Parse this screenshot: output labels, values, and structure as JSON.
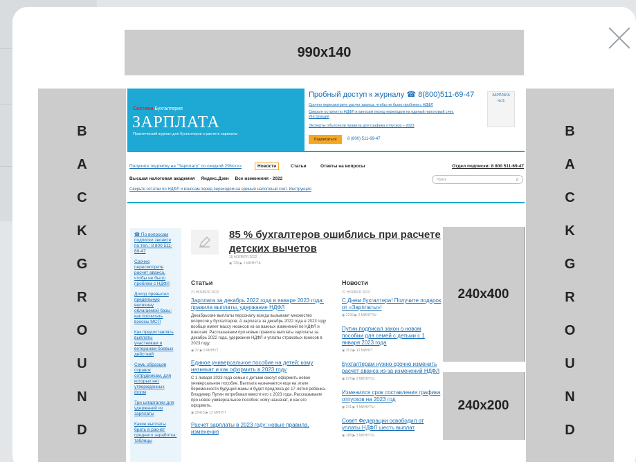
{
  "ads": {
    "top": "990x140",
    "right_tall": "240x400",
    "right_short": "240x200",
    "background_letters": [
      "B",
      "A",
      "C",
      "K",
      "G",
      "R",
      "O",
      "U",
      "N",
      "D"
    ]
  },
  "site": {
    "brand_small": "Бухгалтерия",
    "brand_accent": "Система",
    "title": "ЗАРПЛАТА",
    "tagline": "Практический журнал для бухгалтеров о расчете зарплаты",
    "trial": "Пробный доступ к журналу ☎ 8(800)511-69-47",
    "header_links": [
      "Срочно пересмотрите расчет аванса, чтобы не было проблем с НДФЛ",
      "Сверьте остатки по НДФЛ и взносам перед переходом на единый налоговый счет. Инструкция",
      "Эксперты объяснили правила для графика отпусков – 2023"
    ],
    "subscribe_button": "Подписаться",
    "phone": "8 (800) 511-69-47",
    "cover_title": "ЗАРПЛАТА",
    "cover_issue": "№11",
    "nav_subscribe": "Получите подписку на \"Зарплату\" со скидкой 29%>>>",
    "nav_news": "Новости",
    "nav_articles": "Статьи",
    "nav_questions": "Ответы на вопросы",
    "nav_dept": "Отдел подписки: 8 800 511-69-47",
    "nav2": [
      "Высшая налоговая академия",
      "Яндекс.Дзен",
      "Все изменения - 2022"
    ],
    "search_placeholder": "Поиск",
    "nav3": "Сверьте остатки по НДФЛ и взносам перед переходом на единый налоговый счет. Инструкция",
    "sidebar": [
      "☎ По вопросам подписки звоните по тел.: 8 800 511-69-47",
      "Срочно пересмотрите расчет аванса, чтобы не было проблем с НДФЛ",
      "Доход превысил предельную величину облагаемой базы: как посчитать взносы МСП",
      "Как предоставлять выплаты участникам и ветеранам боевых действий",
      "Семь образцов справок сотрудникам, для которых нет утвержденных форм",
      "Три шпаргалки для удержаний из зарплаты",
      "Какие выплаты брать в расчет среднего заработка: таблицы"
    ],
    "featured": {
      "title": "85 % бухгалтеров ошиблись при расчете детских вычетов",
      "date": "15 НОЯБРЯ 2022",
      "meta": "◉ 726   ▶ 1 МИНУТА"
    },
    "articles": {
      "heading": "Статьи",
      "date": "21 НОЯБРЯ 2022",
      "items": [
        {
          "title": "Зарплата за декабрь 2022 года в январе 2023 года: правила выплаты, удержание НДФЛ",
          "text": "Декабрьские выплаты персоналу всегда вызывают множество вопросов у бухгалтеров. А зарплата за декабрь 2022 года в 2023 году вообще имеет массу нюансов из-за важных изменений по НДФЛ и взносам. Рассказываем про новые правила выплаты зарплаты за декабрь 2022 года, удержание НДФЛ и уплаты страховых взносов в 2023 году.",
          "meta": "◉ 37   ▶ 9 МИНУТ"
        },
        {
          "title": "Единое универсальное пособие на детей: кому назначат и как оформить в 2023 году",
          "text": "С 1 января 2023 года семьи с детьми смогут оформить новое универсальное пособие. Выплата назначается еще на этапе беременности будущей мамы и будет продлена до 17-летия ребенка. Владимир Путин потребовал ввести его с 2023 года. Рассказываем про новое универсальное пособие: кому назначат, и как его оформить.",
          "meta": "◉ 25415   ▶ 12 МИНУТ"
        },
        {
          "title": "Расчет зарплаты в 2023 году: новые правила, изменения",
          "text": "",
          "meta": ""
        }
      ]
    },
    "news": {
      "heading": "Новости",
      "date": "21 НОЯБРЯ 2022",
      "items": [
        {
          "title": "С Днем бухгалтера! Получите подарок от «Зарплаты»!",
          "meta": "◉ 2232   ▶ 2 МИНУТЫ"
        },
        {
          "title": "Путин подписал закон о новом пособии для семей с детьми с 1 января 2023 года",
          "meta": "◉ 353   ▶ 10 МИНУТ"
        },
        {
          "title": "Бухгалтерам нужно срочно изменить расчет аванса из-за изменений НДФЛ",
          "meta": "◉ 676   ▶ 2 МИНУТЫ"
        },
        {
          "title": "Изменился срок составления графика отпусков на 2023 год",
          "meta": "◉ 241   ▶ 4 МИНУТЫ"
        },
        {
          "title": "Совет Федерации освободил от уплаты НДФЛ шесть выплат",
          "meta": "◉ 188   ▶ 3 МИНУТЫ"
        }
      ]
    }
  }
}
